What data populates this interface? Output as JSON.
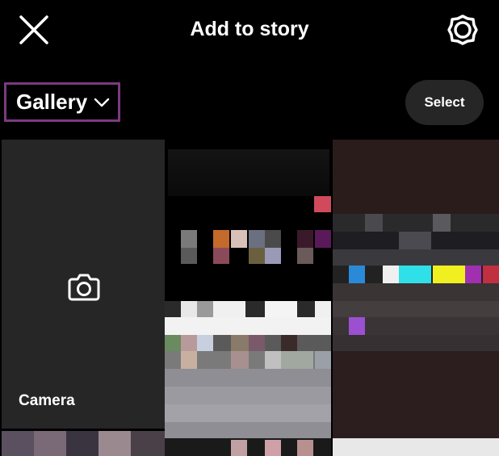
{
  "header": {
    "title": "Add to story",
    "close_icon": "close-icon",
    "settings_icon": "gear-icon"
  },
  "toolbar": {
    "album_label": "Gallery",
    "album_icon": "chevron-down-icon",
    "select_label": "Select"
  },
  "grid": {
    "camera_label": "Camera",
    "camera_icon": "camera-icon"
  },
  "colors": {
    "background": "#000000",
    "tile_dark": "#262626",
    "highlight_border": "#7c3a80"
  }
}
